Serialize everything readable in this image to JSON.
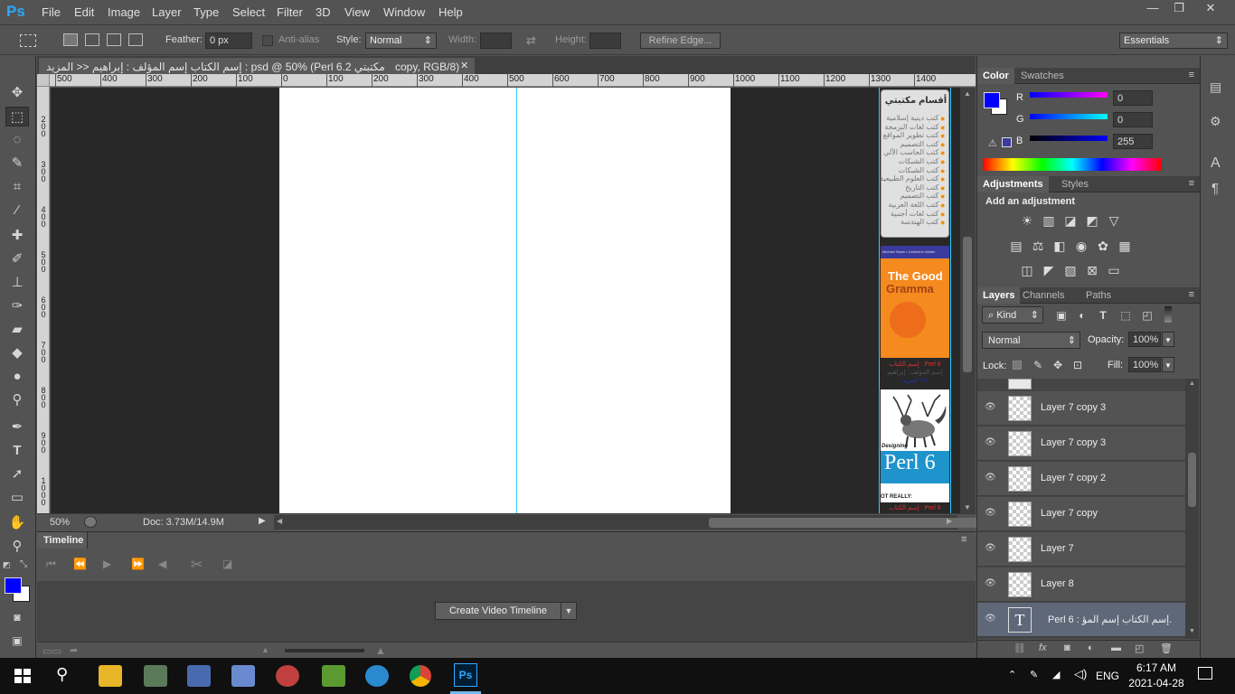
{
  "app": {
    "logo": "Ps"
  },
  "menu": [
    "File",
    "Edit",
    "Image",
    "Layer",
    "Type",
    "Select",
    "Filter",
    "3D",
    "View",
    "Window",
    "Help"
  ],
  "window_controls": {
    "minimize": "—",
    "restore": "❐",
    "close": "✕"
  },
  "options": {
    "feather_label": "Feather:",
    "feather_value": "0 px",
    "antialias_label": "Anti-alias",
    "style_label": "Style:",
    "style_value": "Normal",
    "width_label": "Width:",
    "height_label": "Height:",
    "refine_edge": "Refine Edge...",
    "workspace": "Essentials"
  },
  "document": {
    "tab_title": "مكتبتي 2.psd @ 50% (Perl 6 : إسم الكتاب إسم المؤلف : إبراهيم << المزيد",
    "tab_title_suffix": "copy, RGB/8)",
    "close": "✕"
  },
  "ruler": {
    "h_ticks": [
      "500",
      "400",
      "300",
      "200",
      "100",
      "0",
      "100",
      "200",
      "300",
      "400",
      "500",
      "600",
      "700",
      "800",
      "900",
      "1000",
      "1100",
      "1200",
      "1300",
      "1400"
    ],
    "v_ticks": [
      "2 0 0",
      "3 0 0",
      "4 0 0",
      "5 0 0",
      "6 0 0",
      "7 0 0",
      "8 0 0",
      "9 0 0",
      "1 0 0 0"
    ]
  },
  "canvas": {
    "side_title": "أقسام مكتبتي",
    "side_items": [
      "كتب دينية إسلامية",
      "كتب لغات البرمجة",
      "كتب تطوير المواقع",
      "كتب التصميم",
      "كتب الحاسب الآلي",
      "كتب الشبكات",
      "كتب الشبكات",
      "كتب العلوم الطبيعية",
      "كتب التاريخ",
      "كتب التصميم",
      "كتب اللغة العربية",
      "كتب لغات أجنبية",
      "كتب الهندسة"
    ],
    "book1_authors": "Michael Swan • Catherine Walter",
    "book1_title1": "The Good",
    "book1_title2": "Gramma",
    "book1_caption1": "إسم الكتاب : Perl 6",
    "book1_caption2": "إسم المؤلف : إبراهيم",
    "book1_caption3": "المزيد >>",
    "book2_small": "Designing",
    "book2_title": "Perl 6",
    "book2_band": "OT REALLY:",
    "book2_caption": "إسم الكتاب : Perl 6"
  },
  "status": {
    "zoom": "50%",
    "doc": "Doc: 3.73M/14.9M"
  },
  "timeline": {
    "tab": "Timeline",
    "create_button": "Create Video Timeline"
  },
  "color_panel": {
    "tabs": [
      "Color",
      "Swatches"
    ],
    "r_label": "R",
    "g_label": "G",
    "b_label": "B",
    "r_value": "0",
    "g_value": "0",
    "b_value": "255",
    "fg_color": "#0000ff",
    "bg_color": "#ffffff"
  },
  "adjustments": {
    "tabs": [
      "Adjustments",
      "Styles"
    ],
    "title": "Add an adjustment"
  },
  "layers": {
    "tabs": [
      "Layers",
      "Channels",
      "Paths"
    ],
    "kind": "Kind",
    "blend_mode": "Normal",
    "opacity_label": "Opacity:",
    "opacity_value": "100%",
    "lock_label": "Lock:",
    "fill_label": "Fill:",
    "fill_value": "100%",
    "items": [
      {
        "name": "Layer 7 copy 3"
      },
      {
        "name": "Layer 7 copy 3"
      },
      {
        "name": "Layer 7 copy 2"
      },
      {
        "name": "Layer 7 copy"
      },
      {
        "name": "Layer 7"
      },
      {
        "name": "Layer 8"
      },
      {
        "name": "Perl 6 : إسم الكتاب إسم المؤ..."
      }
    ]
  },
  "taskbar": {
    "time": "6:17 AM",
    "date": "2021-04-28",
    "lang": "ENG",
    "ps_icon": "Ps"
  }
}
